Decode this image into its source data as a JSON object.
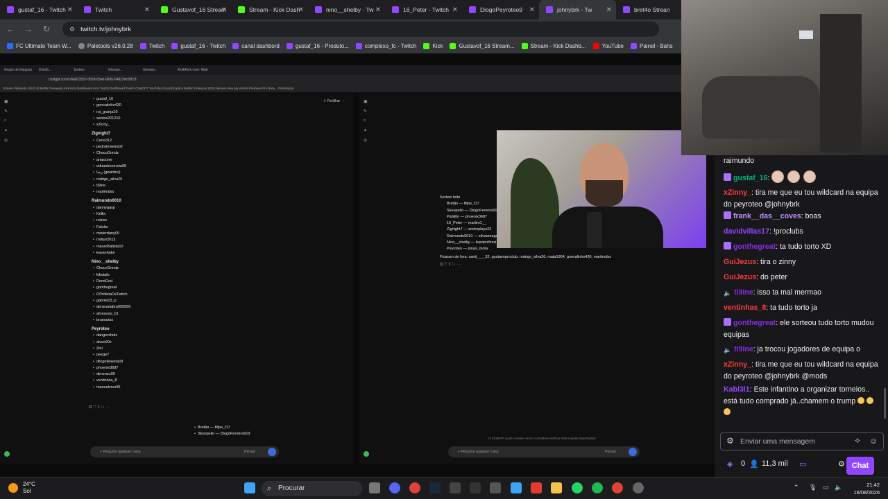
{
  "browser": {
    "tabs": [
      {
        "label": "gustaf_16 - Twitch",
        "fav": "twitch",
        "active": false
      },
      {
        "label": "Twitch",
        "fav": "twitch",
        "active": false
      },
      {
        "label": "Gustavof_16 Stream",
        "fav": "kick",
        "active": false
      },
      {
        "label": "Stream - Kick Dash",
        "fav": "kick",
        "active": false
      },
      {
        "label": "nino__shelby - Tw",
        "fav": "twitch",
        "active": false
      },
      {
        "label": "16_Peter - Twitch",
        "fav": "twitch",
        "active": false
      },
      {
        "label": "DiogoPeyroteo9",
        "fav": "twitch",
        "active": false
      },
      {
        "label": "johnybrk - Tw",
        "fav": "twitch",
        "active": true
      },
      {
        "label": "bret4o Strean",
        "fav": "twitch",
        "active": false
      }
    ],
    "url": "twitch.tv/johnybrk",
    "bookmarks": [
      {
        "label": "FC Ultimate Team W...",
        "fav": "ea"
      },
      {
        "label": "Paletools v26.0.28",
        "fav": "p"
      },
      {
        "label": "Twitch",
        "fav": "twitch"
      },
      {
        "label": "gustaf_16 - Twitch",
        "fav": "twitch"
      },
      {
        "label": "canal dashbord",
        "fav": "twitch"
      },
      {
        "label": "gustaf_16 - Produto...",
        "fav": "twitch"
      },
      {
        "label": "complexo_fc - Twitch",
        "fav": "twitch"
      },
      {
        "label": "Kick",
        "fav": "kick"
      },
      {
        "label": "Gustavof_16 Stream...",
        "fav": "kick"
      },
      {
        "label": "Stream - Kick Dashb...",
        "fav": "kick"
      },
      {
        "label": "YouTube",
        "fav": "youtube"
      },
      {
        "label": "Painel - Bahs",
        "fav": "twitch"
      }
    ]
  },
  "stream": {
    "inner_tabs": [
      "Grupo de Equipas",
      "Distrib...",
      "Sorteio",
      "Giveaw...",
      "Giveaw...",
      "MultiKick.com: Watch Multip..."
    ],
    "inner_url": "chatgpt.com/c/6a821557-0659-83eb-96d5-64823dc8f103",
    "inner_bookmarks": "Stream  Paletools v26.0.24  Botfik  Giveaway  Kick  Kick Dashboard  Kick  Twitch Dashboard  Twitch  ChatGPT  YouTube  Gmail  Dropbox  Betclic  Finanças 2026  Harvest  view  My orders  Premiere Pro Brea...  Finalização",
    "left_groups": [
      {
        "name": "",
        "items": [
          "gustaf_16",
          "goncalinho430",
          "rui_granja10",
          "santos201210",
          "xZinny_"
        ]
      },
      {
        "name": "Zignight7",
        "items": [
          "Cena312",
          "pedroteixeira02",
          "ChocoGrindz",
          "anascore",
          "eduardocorreia98",
          "رضا (gwartins)",
          "rodrigo_silva25",
          "ti9ine",
          "martimdss"
        ]
      },
      {
        "name": "Raimundo0010",
        "items": [
          "dannygasp",
          "Krillin",
          "roizao",
          "Falcão",
          "misterdany09",
          "rodryx2013",
          "mauroBatista10",
          "kavanhake"
        ]
      },
      {
        "name": "Nino__shelby",
        "items": [
          "ChocoGrindz",
          "kikotate",
          "DemiGod",
          "gonthegreat",
          "OProfetaDaTwitch",
          "gabriel23_p",
          "abracadabra999999",
          "afonsooo_01",
          "brunoutss"
        ]
      },
      {
        "name": "Peyroteo",
        "items": [
          "dangershotz",
          "alves90x",
          "Zini",
          "peege7",
          "diiogoteixeira09",
          "phoenix3687",
          "dimenez99",
          "ventinhas_8",
          "manuelcruz95"
        ]
      }
    ],
    "partilhar": "Partilhar",
    "left_bottom": [
      "Bretão — filipe_f17",
      "Skoopelio — DiogoFerreira919"
    ],
    "input_placeholder": "Pergunte qualquer coisa",
    "pensar": "Pensar",
    "result_title": "Sorteio feito",
    "result_items": [
      "Bretão — filipe_f17",
      "Skoopelio — DiogoFerreira919",
      "Pabilito — phoenix3687",
      "16_Peter — martim1__",
      "Zignight7 — andreplays23",
      "Raimundo0010 — silvaamagouveia",
      "Nino__shelby — baratosfcxxi",
      "Peyroteo — jonas_mota"
    ],
    "result_out": "Ficaram de fora: santi____32, gustavoproclub, rodrigo_silva26, mata1904, goncalinho430, martimdss",
    "disclaimer": "O ChatGPT pode cometer erros. Considere verificar informações importantes."
  },
  "chat": {
    "messages": [
      {
        "user": "",
        "text": "raimundo",
        "color": "#efeff1",
        "badge": "none"
      },
      {
        "user": "gustaf_16",
        "text": ":",
        "color": "#00b37a",
        "badge": "sub",
        "emotes": 3
      },
      {
        "user": "xZinny_",
        "text": ": tira me que eu tou wildcard na equipa do peyroteo @johnybrk",
        "color": "#ff3b3b",
        "badge": "none"
      },
      {
        "user": "frank__das__coves",
        "text": ": boas",
        "color": "#b995ff",
        "badge": "sub"
      },
      {
        "user": "davidvillas17",
        "text": ": !proclubs",
        "color": "#9146ff",
        "badge": "none"
      },
      {
        "user": "gonthegreat",
        "text": ": ta tudo torto XD",
        "color": "#8a2be2",
        "badge": "sub"
      },
      {
        "user": "GuiJezus",
        "text": ": tira o zinny",
        "color": "#ff3b3b",
        "badge": "none"
      },
      {
        "user": "GuiJezus",
        "text": ": do peter",
        "color": "#ff3b3b",
        "badge": "none"
      },
      {
        "user": "ti9ine",
        "text": ": isso ta mal mermao",
        "color": "#8a2be2",
        "badge": "sound"
      },
      {
        "user": "ventinhas_8",
        "text": ": ta tudo torto ja",
        "color": "#ff3b3b",
        "badge": "none"
      },
      {
        "user": "gonthegreat",
        "text": ": ele sorteou tudo torto mudou equipas",
        "color": "#8a2be2",
        "badge": "sub"
      },
      {
        "user": "ti9ine",
        "text": ": ja trocou jogadores de equipa o",
        "color": "#8a2be2",
        "badge": "sound"
      },
      {
        "user": "xZinny_",
        "text": ": tira me que eu tou wildcard na equipa do peyroteo @johnybrk @mods",
        "color": "#ff3b3b",
        "badge": "none"
      },
      {
        "user": "Kabl3i1",
        "text": ": Este infantino a organizar torneios.. está tudo comprado já..chamem o trump",
        "color": "#9146ff",
        "badge": "none",
        "emojis": 3
      }
    ],
    "input_placeholder": "Enviar uma mensagem",
    "points": "0",
    "viewers": "11,3 mil",
    "chat_button": "Chat"
  },
  "taskbar": {
    "temperature": "24°C",
    "weather": "Sol",
    "search": "Procurar",
    "time": "21:42",
    "date": "16/08/2026"
  }
}
